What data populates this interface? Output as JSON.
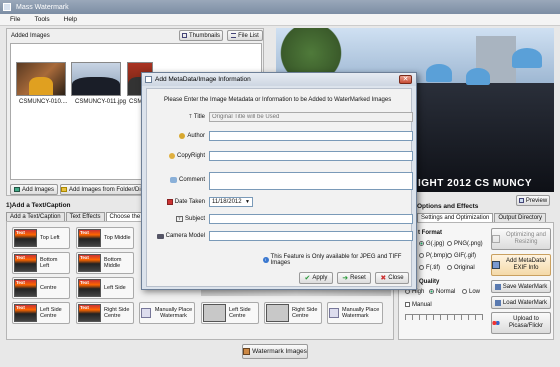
{
  "window": {
    "title": "Mass Watermark"
  },
  "menu": [
    "File",
    "Tools",
    "Help"
  ],
  "added_images": {
    "heading": "Added Images",
    "view_buttons": {
      "thumbnails": "Thumbnails",
      "file_list": "File List"
    },
    "thumbs": [
      {
        "name": "CSMUNCY-010...."
      },
      {
        "name": "CSMUNCY-011.jpg"
      },
      {
        "name": "CSMUNC"
      }
    ],
    "add_images": "Add Images",
    "add_from_folder": "Add Images from Folder/Di"
  },
  "preview": {
    "caption": "IGHT 2012 CS MUNCY",
    "preview_button": "Preview"
  },
  "caption_section": {
    "heading": "1)Add a Text/Caption",
    "tabs": [
      "Add a Text/Caption",
      "Text Effects",
      "Choose the Tex"
    ],
    "badge": "Text",
    "positions": [
      "Top Left",
      "Top Middle",
      "Bottom Left",
      "Bottom Middle",
      "Centre",
      "Left Side",
      "Left Side Centre",
      "Right Side Centre"
    ],
    "manual": "Manually Place Watermark",
    "image_positions": [
      "Left Side Centre",
      "Right Side Centre"
    ],
    "manual2": "Manually Place Watermark"
  },
  "output": {
    "heading": "Options and Effects",
    "tabs": [
      "Settings and Optimization",
      "Output Directory"
    ],
    "format_heading": "t Format",
    "formats": [
      "G(.jpg)",
      "PNG(.png)",
      "P(.bmp)",
      "GIF(.gif)",
      "F(.tif)",
      "Original"
    ],
    "quality_heading": "Quality",
    "quality": [
      "High",
      "Normal",
      "Low"
    ],
    "manual_label": "Manual",
    "side_buttons": [
      "Optimizing and Resizing",
      "Add MetaData/ EXIF Info",
      "Save WaterMark",
      "Load WaterMark",
      "Upload to Picasa/Flickr"
    ]
  },
  "watermark_button": "Watermark Images",
  "dialog": {
    "title": "Add MetaData/Image Information",
    "instruction": "Please Enter the Image Metadata or Information to be Added to WaterMarked Images",
    "fields": {
      "title_label": "Title",
      "title_placeholder": "Original Title will be Used",
      "author_label": "Author",
      "copyright_label": "CopyRight",
      "comment_label": "Comment",
      "date_label": "Date Taken",
      "date_value": "11/18/2012",
      "subject_label": "Subject",
      "camera_label": "Camera Model"
    },
    "note": "This Feature is Only available for JPEG and TIFF Images",
    "buttons": {
      "apply": "Apply",
      "reset": "Reset",
      "close": "Close"
    }
  }
}
